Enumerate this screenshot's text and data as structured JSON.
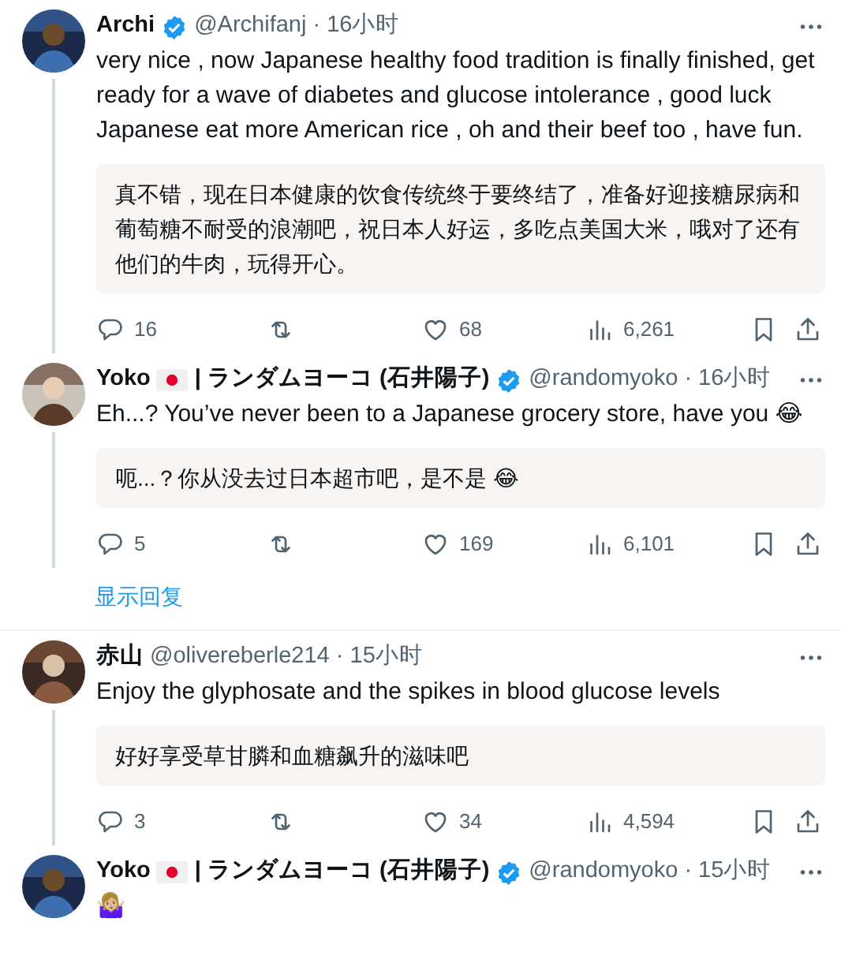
{
  "threads": [
    {
      "tweets": [
        {
          "name": "Archi",
          "flag": false,
          "verified": true,
          "meta": "@Archifanj · 16小时",
          "text": "very nice , now Japanese healthy food tradition is finally finished, get ready for a wave of diabetes and glucose intolerance , good luck Japanese eat more American rice , oh and their beef too , have fun.",
          "translation": "真不错，现在日本健康的饮食传统终于要终结了，准备好迎接糖尿病和葡萄糖不耐受的浪潮吧，祝日本人好运，多吃点美国大米，哦对了还有他们的牛肉，玩得开心。",
          "actions": {
            "replies": "16",
            "likes": "68",
            "views": "6,261"
          }
        },
        {
          "name": "Yoko",
          "flag": true,
          "name_suffix": "| ランダムヨーコ (石井陽子)",
          "verified": true,
          "meta": "@randomyoko · 16小时",
          "text": "Eh...? You’ve never been to a Japanese grocery store, have you 😂",
          "translation": "呃...？你从没去过日本超市吧，是不是 😂",
          "actions": {
            "replies": "5",
            "likes": "169",
            "views": "6,101"
          }
        }
      ],
      "show_replies": "显示回复"
    },
    {
      "tweets": [
        {
          "name": "赤山",
          "flag": false,
          "verified": false,
          "meta": "@olivereberle214 · 15小时",
          "text": "Enjoy the glyphosate and the spikes in blood glucose levels",
          "translation": "好好享受草甘膦和血糖飙升的滋味吧",
          "actions": {
            "replies": "3",
            "likes": "34",
            "views": "4,594"
          }
        },
        {
          "name": "Yoko",
          "flag": true,
          "name_suffix": "| ランダムヨーコ (石井陽子)",
          "verified": true,
          "meta": "@randomyoko · 15小时",
          "text": "🤷🏼‍♀️"
        }
      ]
    }
  ]
}
